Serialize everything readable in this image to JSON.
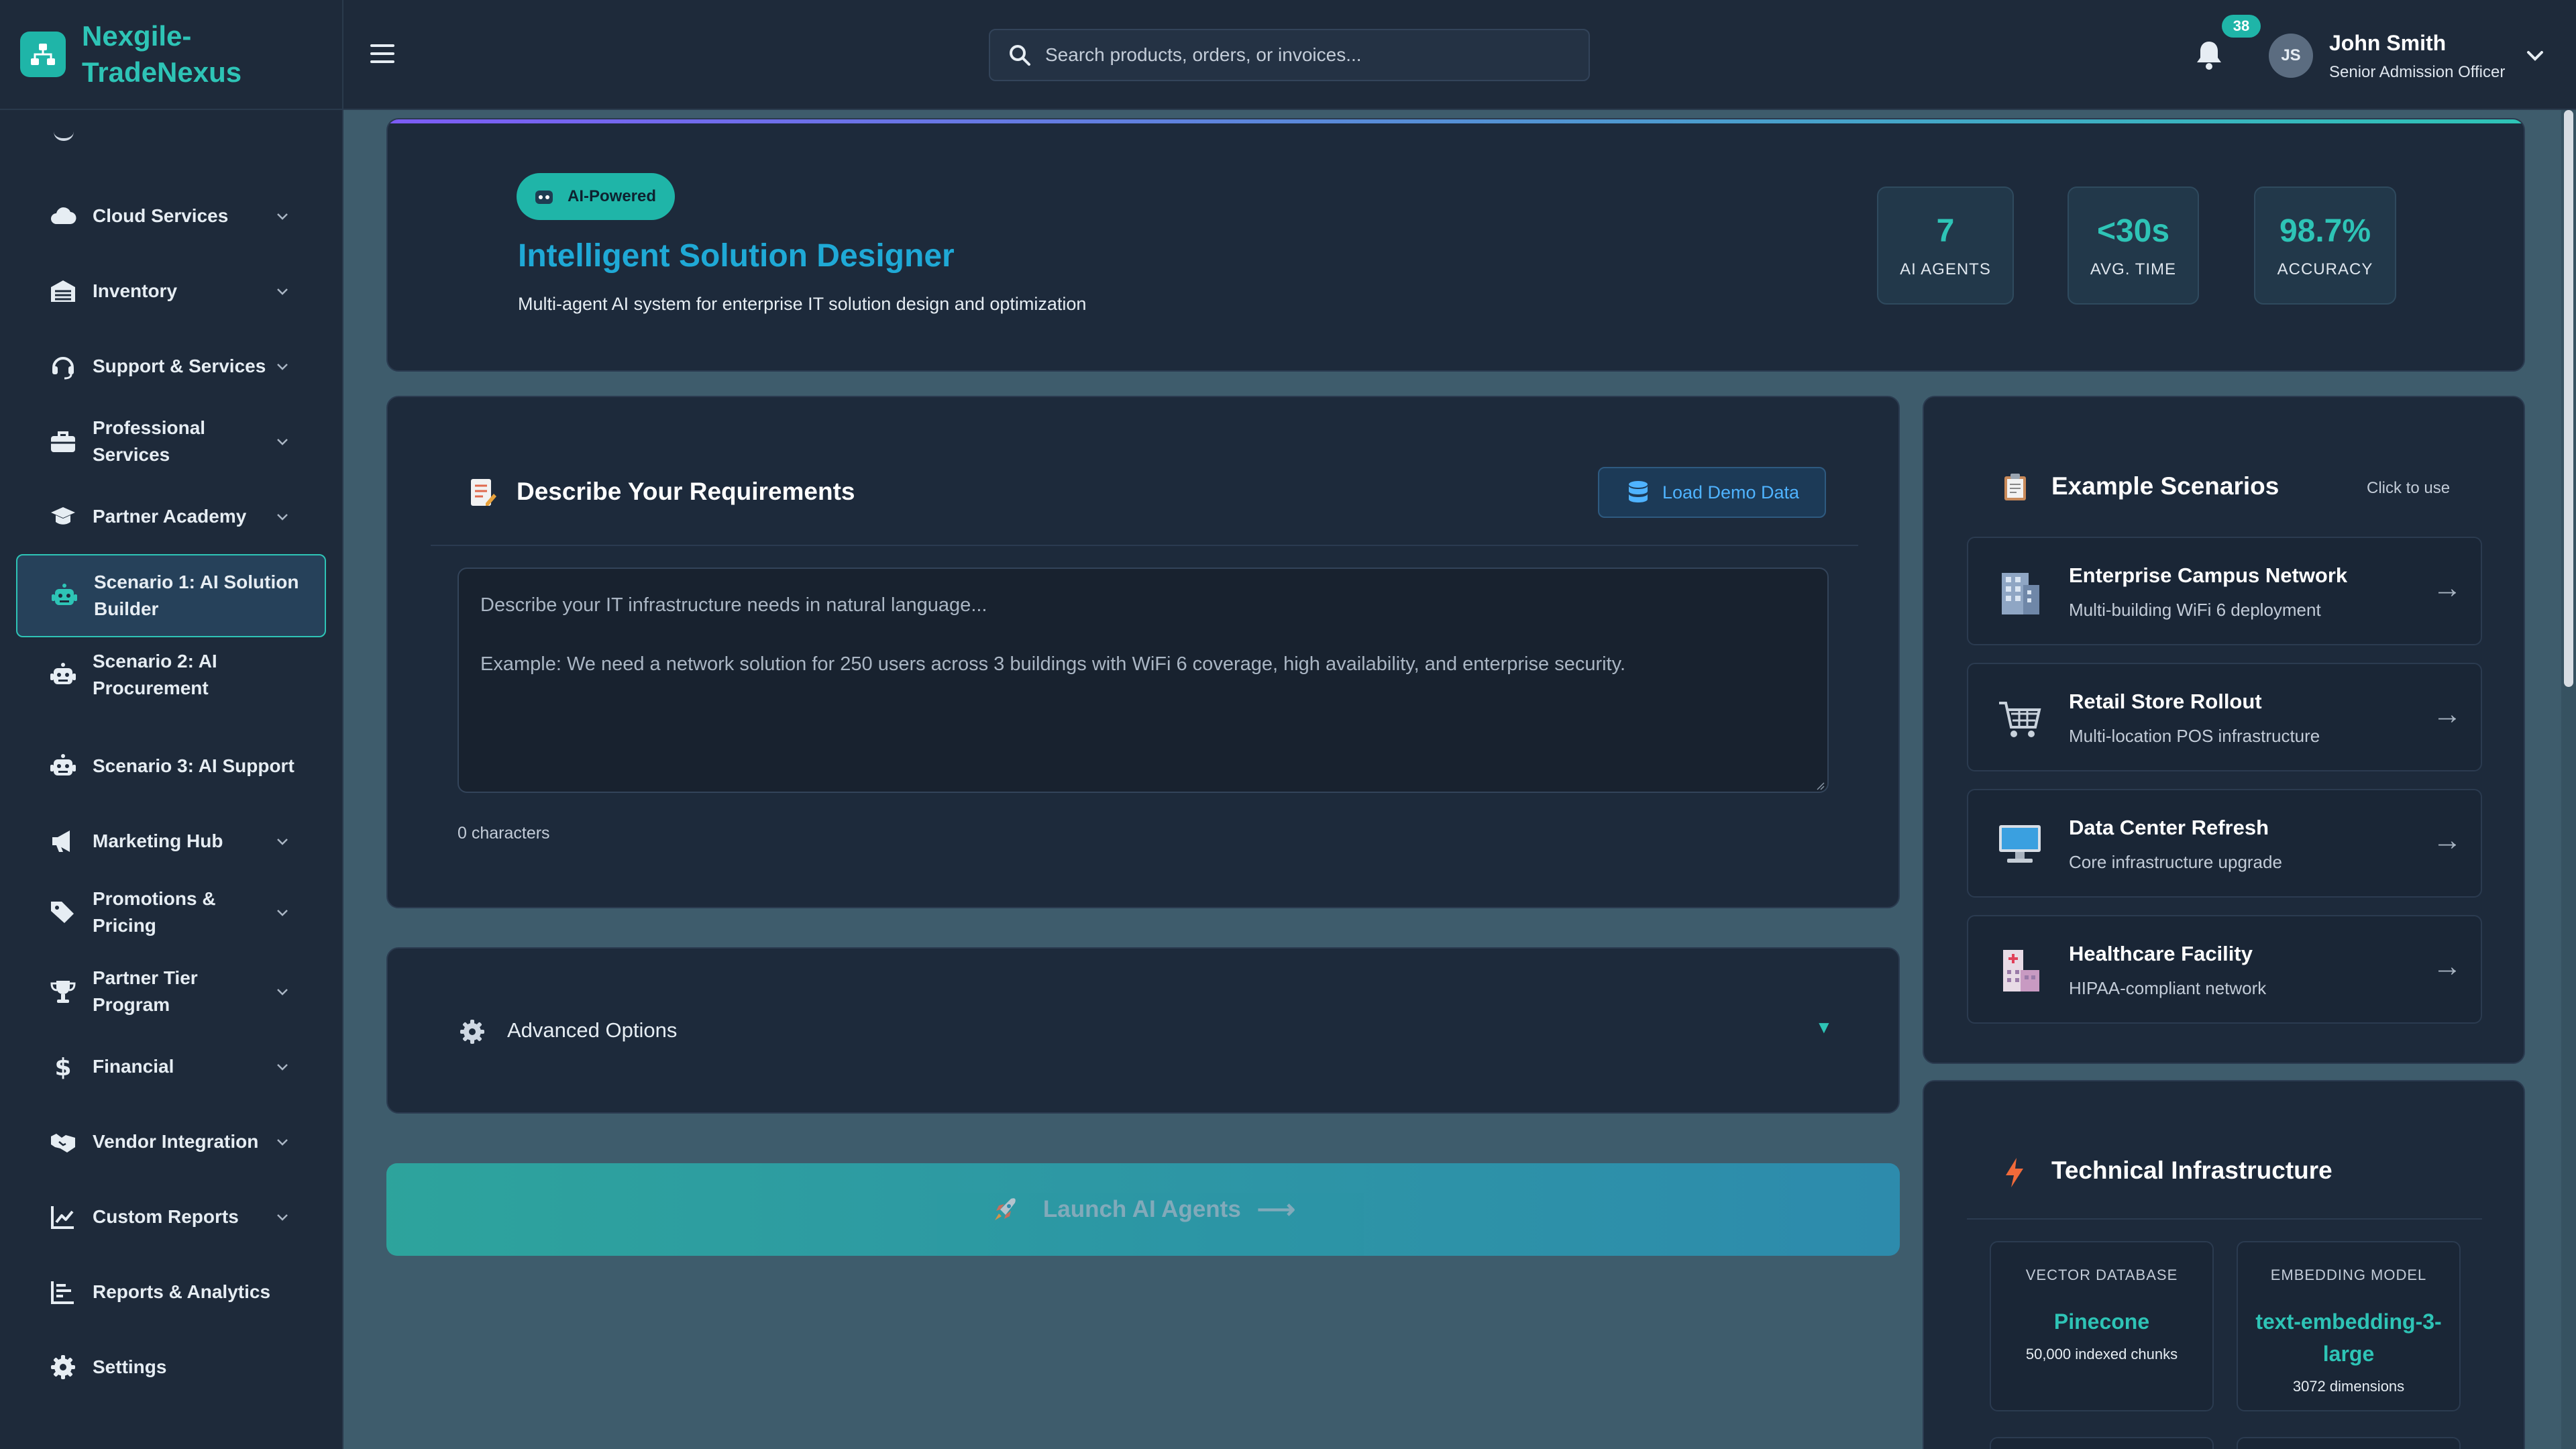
{
  "brand": {
    "name": "Nexgile-TradeNexus"
  },
  "sidebar": {
    "items": [
      {
        "label": "Cloud Services",
        "icon": "cloud-icon",
        "chevron": true,
        "active": false
      },
      {
        "label": "Inventory",
        "icon": "warehouse-icon",
        "chevron": true,
        "active": false
      },
      {
        "label": "Support & Services",
        "icon": "headset-icon",
        "chevron": true,
        "active": false
      },
      {
        "label": "Professional Services",
        "icon": "briefcase-icon",
        "chevron": true,
        "active": false
      },
      {
        "label": "Partner Academy",
        "icon": "graduation-cap-icon",
        "chevron": true,
        "active": false
      },
      {
        "label": "Scenario 1: AI Solution Builder",
        "icon": "robot-icon",
        "chevron": false,
        "active": true
      },
      {
        "label": "Scenario 2: AI Procurement",
        "icon": "robot-icon",
        "chevron": false,
        "active": false
      },
      {
        "label": "Scenario 3: AI Support",
        "icon": "robot-icon",
        "chevron": false,
        "active": false
      },
      {
        "label": "Marketing Hub",
        "icon": "megaphone-icon",
        "chevron": true,
        "active": false
      },
      {
        "label": "Promotions & Pricing",
        "icon": "tags-icon",
        "chevron": true,
        "active": false
      },
      {
        "label": "Partner Tier Program",
        "icon": "trophy-icon",
        "chevron": true,
        "active": false
      },
      {
        "label": "Financial",
        "icon": "dollar-icon",
        "chevron": true,
        "active": false
      },
      {
        "label": "Vendor Integration",
        "icon": "handshake-icon",
        "chevron": true,
        "active": false
      },
      {
        "label": "Custom Reports",
        "icon": "line-chart-icon",
        "chevron": true,
        "active": false
      },
      {
        "label": "Reports & Analytics",
        "icon": "list-chart-icon",
        "chevron": false,
        "active": false
      },
      {
        "label": "Settings",
        "icon": "gear-icon",
        "chevron": false,
        "active": false
      }
    ]
  },
  "topbar": {
    "search_placeholder": "Search products, orders, or invoices...",
    "notifications_count": "38",
    "user": {
      "initials": "JS",
      "name": "John Smith",
      "role": "Senior Admission Officer"
    }
  },
  "hero": {
    "badge": "AI-Powered",
    "title": "Intelligent Solution Designer",
    "subtitle": "Multi-agent AI system for enterprise IT solution design and optimization",
    "stats": [
      {
        "value": "7",
        "label": "AI AGENTS"
      },
      {
        "value": "<30s",
        "label": "AVG. TIME"
      },
      {
        "value": "98.7%",
        "label": "ACCURACY"
      }
    ]
  },
  "requirements": {
    "title": "Describe Your Requirements",
    "demo_button": "Load Demo Data",
    "placeholder": "Describe your IT infrastructure needs in natural language...\n\nExample: We need a network solution for 250 users across 3 buildings with WiFi 6 coverage, high availability, and enterprise security.",
    "char_count": "0 characters"
  },
  "advanced": {
    "label": "Advanced Options",
    "caret": "▼"
  },
  "launch": {
    "label": "Launch AI Agents",
    "arrow": "⟶"
  },
  "examples": {
    "title": "Example Scenarios",
    "hint": "Click to use",
    "items": [
      {
        "title": "Enterprise Campus Network",
        "desc": "Multi-building WiFi 6 deployment",
        "icon": "office-building-icon"
      },
      {
        "title": "Retail Store Rollout",
        "desc": "Multi-location POS infrastructure",
        "icon": "shopping-cart-icon"
      },
      {
        "title": "Data Center Refresh",
        "desc": "Core infrastructure upgrade",
        "icon": "desktop-computer-icon"
      },
      {
        "title": "Healthcare Facility",
        "desc": "HIPAA-compliant network",
        "icon": "hospital-icon"
      }
    ]
  },
  "tech": {
    "title": "Technical Infrastructure",
    "boxes": [
      {
        "key": "VECTOR DATABASE",
        "name": "Pinecone",
        "sub": "50,000 indexed chunks"
      },
      {
        "key": "EMBEDDING MODEL",
        "name": "text-embedding-3-large",
        "sub": "3072 dimensions"
      }
    ]
  },
  "colors": {
    "accent": "#2ec4b6",
    "title_blue": "#1fa9d6",
    "panel": "#1d2a3b",
    "sidebar": "#1e2a3a",
    "background": "#3e5c6c"
  }
}
